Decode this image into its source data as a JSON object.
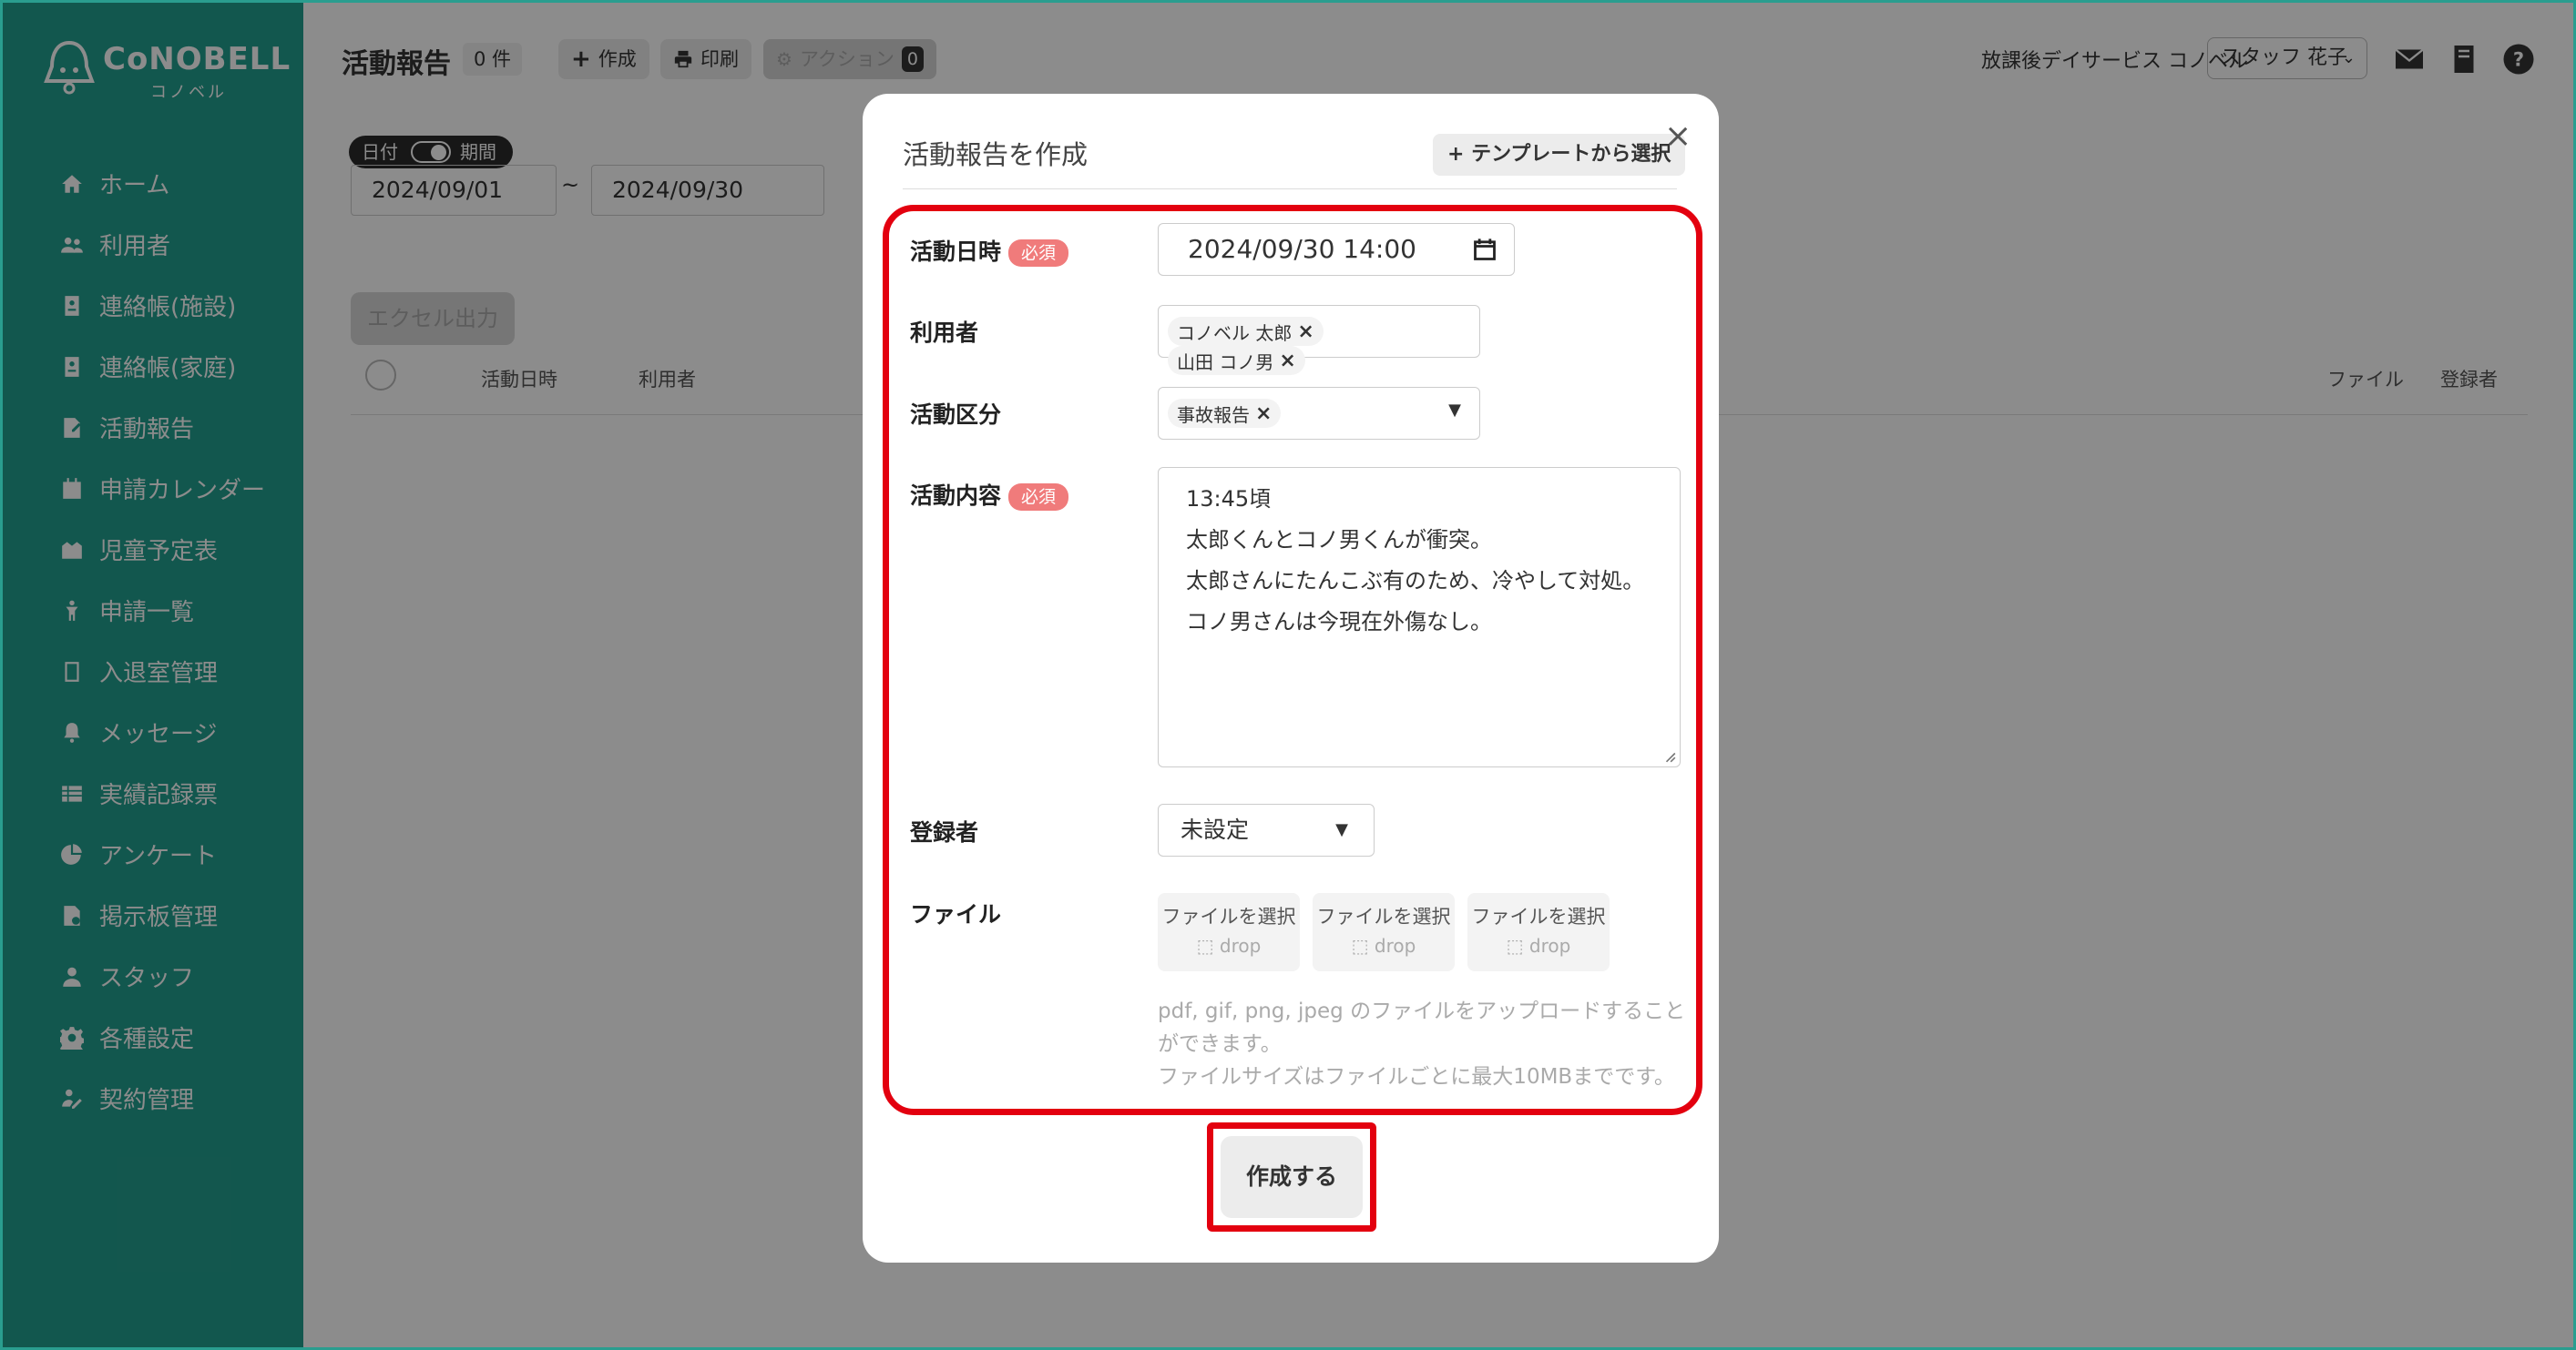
{
  "brand": {
    "logo_text": "CoNOBELL",
    "logo_sub": "コノベル"
  },
  "sidebar": {
    "items": [
      {
        "label": "ホーム",
        "icon": "home-icon"
      },
      {
        "label": "利用者",
        "icon": "users-icon"
      },
      {
        "label": "連絡帳(施設)",
        "icon": "contact-book-icon"
      },
      {
        "label": "連絡帳(家庭)",
        "icon": "contact-book-icon"
      },
      {
        "label": "活動報告",
        "icon": "report-icon"
      },
      {
        "label": "申請カレンダー",
        "icon": "calendar-icon"
      },
      {
        "label": "児童予定表",
        "icon": "schedule-icon"
      },
      {
        "label": "申請一覧",
        "icon": "child-icon"
      },
      {
        "label": "入退室管理",
        "icon": "tablet-icon"
      },
      {
        "label": "メッセージ",
        "icon": "bell-icon"
      },
      {
        "label": "実績記録票",
        "icon": "table-icon"
      },
      {
        "label": "アンケート",
        "icon": "pie-icon"
      },
      {
        "label": "掲示板管理",
        "icon": "board-icon"
      },
      {
        "label": "スタッフ",
        "icon": "staff-icon"
      },
      {
        "label": "各種設定",
        "icon": "gear-icon"
      },
      {
        "label": "契約管理",
        "icon": "contract-icon"
      }
    ]
  },
  "header": {
    "title": "活動報告",
    "count": "0 件",
    "create_label": "作成",
    "print_label": "印刷",
    "action_label": "アクション",
    "action_count": "0",
    "facility": "放課後デイサービス コノベル",
    "staff": "スタッフ 花子"
  },
  "filters": {
    "toggle_date": "日付",
    "toggle_period": "期間",
    "date_from": "2024/09/01",
    "tilde": "~",
    "date_to": "2024/09/30",
    "excel_label": "エクセル出力"
  },
  "table": {
    "headers": [
      "活動日時",
      "利用者",
      "ファイル",
      "登録者"
    ]
  },
  "modal": {
    "title": "活動報告を作成",
    "template_label": "テンプレートから選択",
    "close": "×",
    "required_label": "必須",
    "fields": {
      "datetime_label": "活動日時",
      "datetime_value": "2024/09/30 14:00",
      "users_label": "利用者",
      "users": [
        "コノベル 太郎",
        "山田 コノ男"
      ],
      "category_label": "活動区分",
      "categories": [
        "事故報告"
      ],
      "content_label": "活動内容",
      "content_lines": [
        "13:45頃",
        "太郎くんとコノ男くんが衝突。",
        "太郎さんにたんこぶ有のため、冷やして対処。",
        "コノ男さんは今現在外傷なし。"
      ],
      "registrant_label": "登録者",
      "registrant_value": "未設定",
      "file_label": "ファイル",
      "file_select_label": "ファイルを選択",
      "file_drop_label": "drop",
      "note_line1": "pdf, gif, png, jpeg のファイルをアップロードすることができます。",
      "note_line2": "ファイルサイズはファイルごとに最大10MBまでです。"
    },
    "submit_label": "作成する"
  },
  "colors": {
    "accent": "#229e8e",
    "highlight": "#e3000f",
    "required": "#f07b7b"
  }
}
